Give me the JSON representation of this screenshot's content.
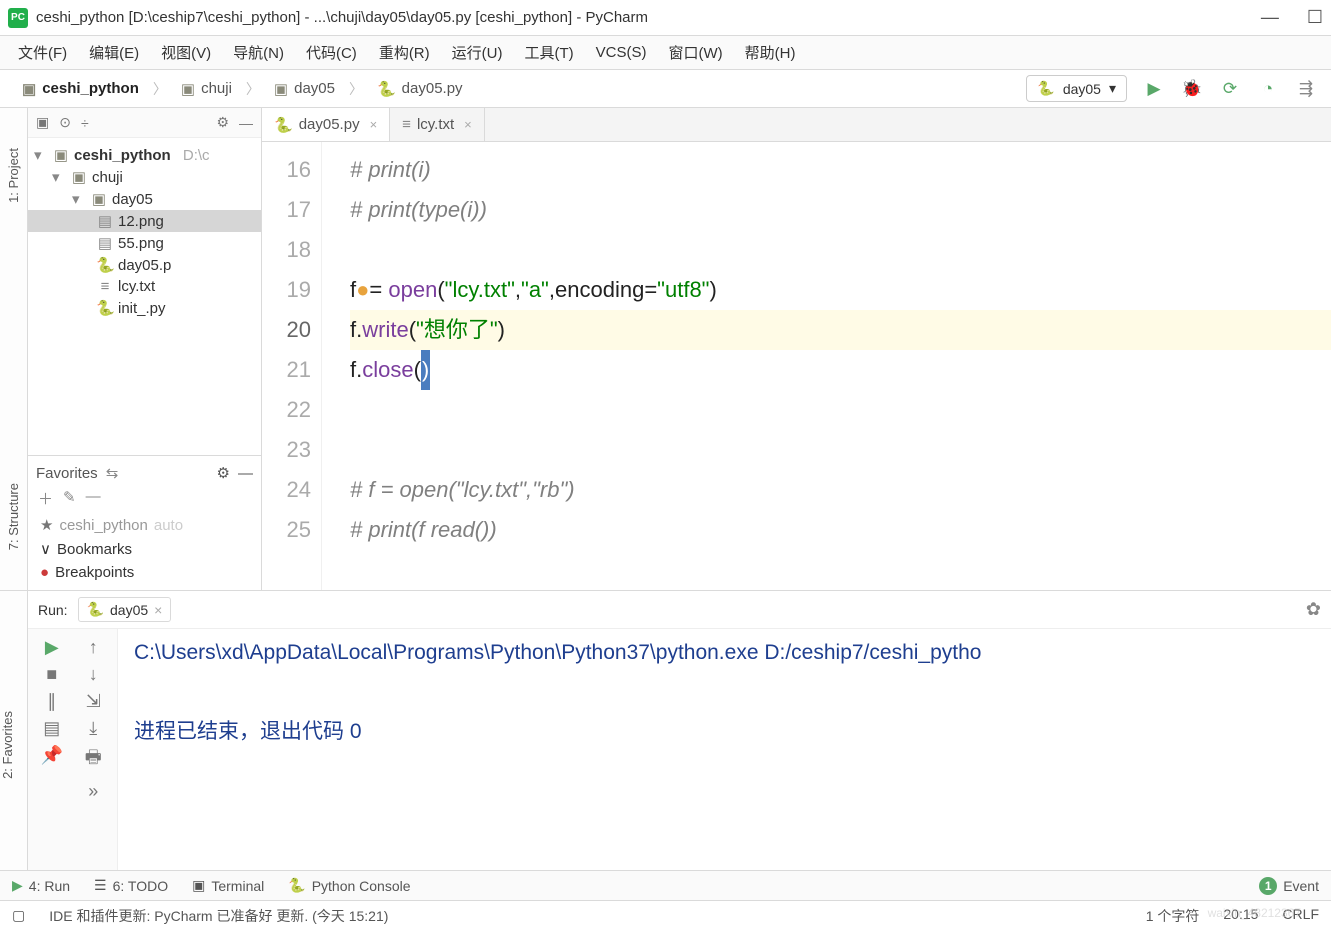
{
  "title": "ceshi_python [D:\\ceship7\\ceshi_python] - ...\\chuji\\day05\\day05.py [ceshi_python] - PyCharm",
  "menubar": [
    "文件(F)",
    "编辑(E)",
    "视图(V)",
    "导航(N)",
    "代码(C)",
    "重构(R)",
    "运行(U)",
    "工具(T)",
    "VCS(S)",
    "窗口(W)",
    "帮助(H)"
  ],
  "breadcrumbs": [
    "ceshi_python",
    "chuji",
    "day05",
    "day05.py"
  ],
  "run_config": "day05",
  "left_rails": [
    "1: Project",
    "7: Structure",
    "2: Favorites"
  ],
  "project_root": {
    "name": "ceshi_python",
    "path": "D:\\c"
  },
  "tree": {
    "root": "ceshi_python",
    "root_path": "D:\\c",
    "chuji": "chuji",
    "day05": "day05",
    "files": [
      "12.png",
      "55.png",
      "day05.p",
      "lcy.txt",
      "init_.py"
    ]
  },
  "favorites": {
    "title": "Favorites",
    "items": [
      {
        "icon": "star",
        "label": "ceshi_python",
        "suffix": "auto"
      },
      {
        "icon": "check",
        "label": "Bookmarks"
      },
      {
        "icon": "dot",
        "label": "Breakpoints"
      }
    ]
  },
  "editor_tabs": [
    {
      "file": "day05.py",
      "active": true,
      "icon": "py"
    },
    {
      "file": "lcy.txt",
      "active": false,
      "icon": "txt"
    }
  ],
  "gutter": [
    "16",
    "17",
    "18",
    "19",
    "20",
    "21",
    "22",
    "23",
    "24",
    "25"
  ],
  "gutter_current": "20",
  "code": {
    "l16": "# print(i)",
    "l17": "# print(type(i))",
    "l19a": "f",
    "l19eq": "= ",
    "l19open": "open",
    "l19p1": "(",
    "l19s1": "\"lcy.txt\"",
    "l19c1": ",",
    "l19s2": "\"a\"",
    "l19c2": ",",
    "l19kw": "encoding",
    "l19eq2": "=",
    "l19s3": "\"utf8\"",
    "l19p2": ")",
    "l20a": "f.",
    "l20fn": "write",
    "l20p1": "(",
    "l20s": "\"想你了\"",
    "l20p2": ")",
    "l21a": "f.",
    "l21fn": "close",
    "l21p1": "(",
    "l21p2": ")",
    "l24": "# f = open(\"lcy.txt\",\"rb\")",
    "l25": "# print(f read())"
  },
  "run_panel": {
    "label": "Run:",
    "tab": "day05",
    "console_line1": "C:\\Users\\xd\\AppData\\Local\\Programs\\Python\\Python37\\python.exe D:/ceship7/ceshi_pytho",
    "console_line2": "进程已结束，退出代码 0"
  },
  "toolwindows": {
    "run": "4: Run",
    "todo": "6: TODO",
    "terminal": "Terminal",
    "pyconsole": "Python Console",
    "event": "Event ",
    "event_count": "1"
  },
  "status": {
    "message": "IDE 和插件更新: PyCharm 已准备好 更新. (今天 15:21)",
    "chars": "1 个字符",
    "pos": "20:15",
    "le": "CRLF"
  },
  "watermark": "waixin_48212367"
}
